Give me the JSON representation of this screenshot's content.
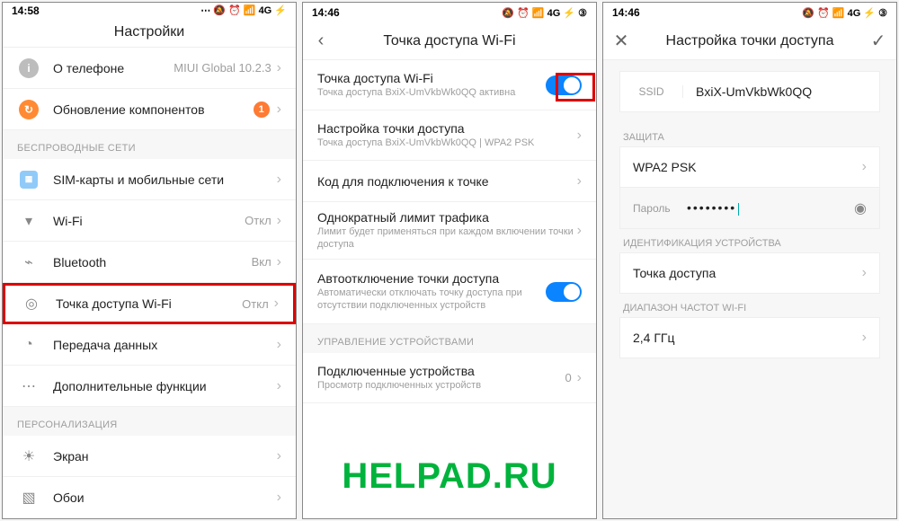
{
  "watermark": "HELPAD.RU",
  "status_icons": "⋯ 🔕 ⏰ 📶 4G ⚡",
  "status_icons_alt": "🔕 ⏰ 📶 4G ⚡ ③",
  "panel1": {
    "time": "14:58",
    "title": "Настройки",
    "about": {
      "label": "О телефоне",
      "value": "MIUI Global 10.2.3"
    },
    "update": {
      "label": "Обновление компонентов",
      "badge": "1"
    },
    "sect_wireless": "БЕСПРОВОДНЫЕ СЕТИ",
    "sim": "SIM-карты и мобильные сети",
    "wifi": {
      "label": "Wi-Fi",
      "value": "Откл"
    },
    "bt": {
      "label": "Bluetooth",
      "value": "Вкл"
    },
    "hotspot": {
      "label": "Точка доступа Wi-Fi",
      "value": "Откл"
    },
    "data": "Передача данных",
    "more": "Дополнительные функции",
    "sect_personal": "ПЕРСОНАЛИЗАЦИЯ",
    "display": "Экран",
    "wallpaper": "Обои"
  },
  "panel2": {
    "time": "14:46",
    "title": "Точка доступа Wi-Fi",
    "hotspot": {
      "label": "Точка доступа Wi-Fi",
      "sub": "Точка доступа BxiX-UmVkbWk0QQ активна"
    },
    "config": {
      "label": "Настройка точки доступа",
      "sub": "Точка доступа BxiX-UmVkbWk0QQ | WPA2 PSK"
    },
    "qr": "Код для подключения к точке",
    "limit": {
      "label": "Однократный лимит трафика",
      "sub": "Лимит будет применяться при каждом включении точки доступа"
    },
    "auto_off": {
      "label": "Автоотключение точки доступа",
      "sub": "Автоматически отключать точку доступа при отсутствии подключенных устройств"
    },
    "sect_devices": "УПРАВЛЕНИЕ УСТРОЙСТВАМИ",
    "devices": {
      "label": "Подключенные устройства",
      "sub": "Просмотр подключенных устройств",
      "count": "0"
    }
  },
  "panel3": {
    "time": "14:46",
    "title": "Настройка точки доступа",
    "ssid_label": "SSID",
    "ssid_value": "BxiX-UmVkbWk0QQ",
    "sect_security": "ЗАЩИТА",
    "security": "WPA2 PSK",
    "pw_label": "Пароль",
    "pw_mask": "••••••••",
    "sect_ident": "ИДЕНТИФИКАЦИЯ УСТРОЙСТВА",
    "ident": "Точка доступа",
    "sect_band": "ДИАПАЗОН ЧАСТОТ WI-FI",
    "band": "2,4 ГГц"
  }
}
